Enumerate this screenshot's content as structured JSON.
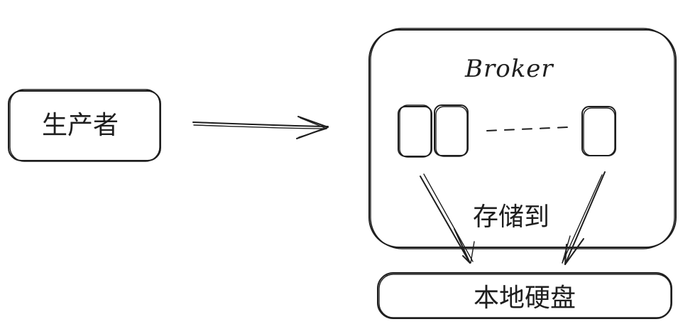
{
  "diagram": {
    "producer": {
      "label": "生产者"
    },
    "broker": {
      "title": "Broker",
      "queue_count_visible": 3
    },
    "store_label": "存储到",
    "disk": {
      "label": "本地硬盘"
    },
    "colors": {
      "stroke": "#1e1e1e",
      "background": "#ffffff"
    }
  }
}
